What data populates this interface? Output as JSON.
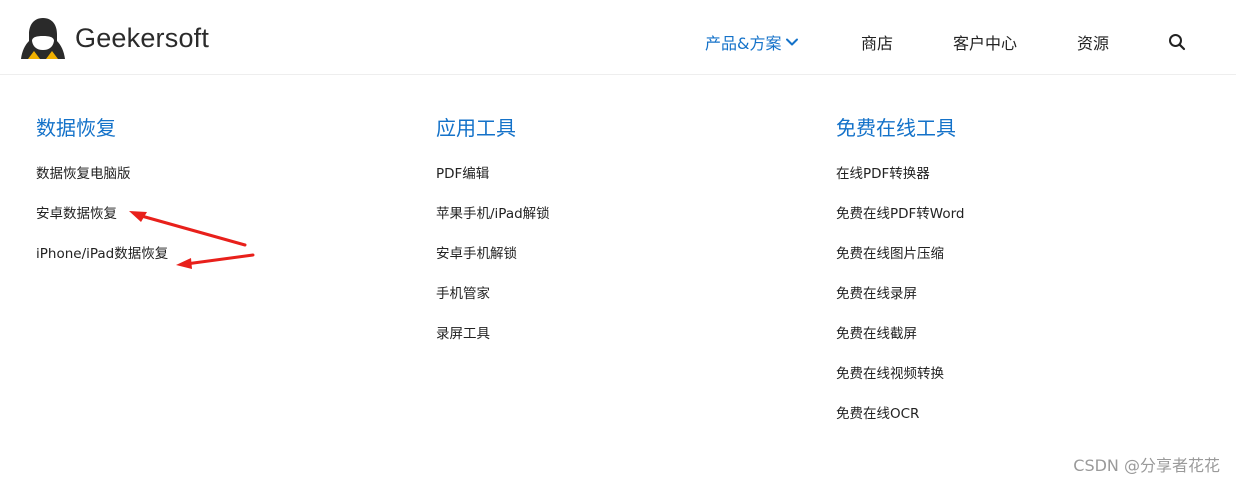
{
  "brand": {
    "name": "Geekersoft"
  },
  "colors": {
    "accent": "#1472c9",
    "text": "#222222",
    "annotation": "#e8201b"
  },
  "nav": {
    "items": [
      {
        "label": "产品&方案",
        "active": true,
        "has_dropdown": true
      },
      {
        "label": "商店"
      },
      {
        "label": "客户中心"
      },
      {
        "label": "资源"
      }
    ],
    "search_icon": "search-icon"
  },
  "menu": {
    "columns": [
      {
        "title": "数据恢复",
        "items": [
          "数据恢复电脑版",
          "安卓数据恢复",
          "iPhone/iPad数据恢复"
        ]
      },
      {
        "title": "应用工具",
        "items": [
          "PDF编辑",
          "苹果手机/iPad解锁",
          "安卓手机解锁",
          "手机管家",
          "录屏工具"
        ]
      },
      {
        "title": "免费在线工具",
        "items": [
          "在线PDF转换器",
          "免费在线PDF转Word",
          "免费在线图片压缩",
          "免费在线录屏",
          "免费在线截屏",
          "免费在线视频转换",
          "免费在线OCR"
        ]
      }
    ]
  },
  "watermark": "CSDN @分享者花花"
}
